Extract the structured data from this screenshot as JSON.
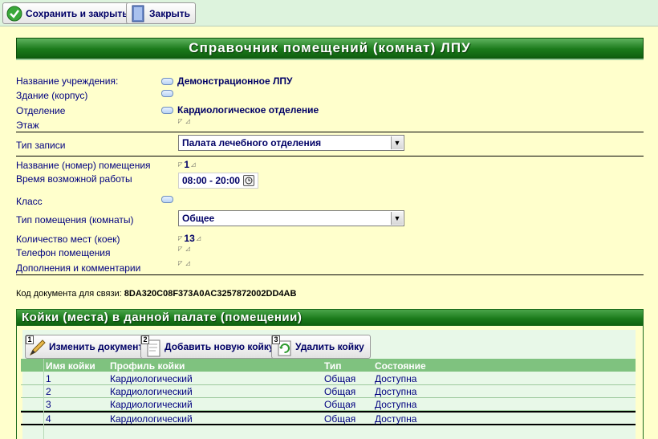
{
  "toolbar": {
    "save_close_label": "Сохранить и закрыть",
    "close_label": "Закрыть"
  },
  "page_title": "Справочник помещений (комнат) ЛПУ",
  "form": {
    "institution": {
      "label": "Название учреждения:",
      "value": "Демонстрационное ЛПУ"
    },
    "building": {
      "label": "Здание (корпус)",
      "value": ""
    },
    "department": {
      "label": "Отделение",
      "value": "Кардиологическое отделение"
    },
    "floor": {
      "label": "Этаж",
      "value": ""
    },
    "record_type": {
      "label": "Тип записи",
      "value": "Палата лечебного отделения"
    },
    "room_name": {
      "label": "Название (номер) помещения",
      "value": "1"
    },
    "work_time": {
      "label": "Время возможной работы",
      "value": "08:00 - 20:00"
    },
    "class": {
      "label": "Класс",
      "value": ""
    },
    "room_type": {
      "label": "Тип помещения (комнаты)",
      "value": "Общее"
    },
    "beds_count": {
      "label": "Количество мест (коек)",
      "value": "13"
    },
    "phone": {
      "label": "Телефон помещения",
      "value": ""
    },
    "comments": {
      "label": "Дополнения и комментарии",
      "value": ""
    }
  },
  "doc_code": {
    "label": "Код документа для связи:",
    "value": "8DA320C08F373A0AC3257872002DD4AB"
  },
  "beds_panel": {
    "title": "Койки (места) в данной палате (помещении)",
    "buttons": [
      {
        "num": "1",
        "label": "Изменить документ"
      },
      {
        "num": "2",
        "label": "Добавить новую койку"
      },
      {
        "num": "3",
        "label": "Удалить койку"
      }
    ],
    "columns": [
      "Имя койки",
      "Профиль койки",
      "Тип",
      "Состояние"
    ],
    "rows": [
      {
        "name": "1",
        "profile": "Кардиологический",
        "type": "Общая",
        "status": "Доступна"
      },
      {
        "name": "2",
        "profile": "Кардиологический",
        "type": "Общая",
        "status": "Доступна"
      },
      {
        "name": "3",
        "profile": "Кардиологический",
        "type": "Общая",
        "status": "Доступна"
      },
      {
        "name": "4",
        "profile": "Кардиологический",
        "type": "Общая",
        "status": "Доступна"
      }
    ],
    "selected_row": "4"
  }
}
